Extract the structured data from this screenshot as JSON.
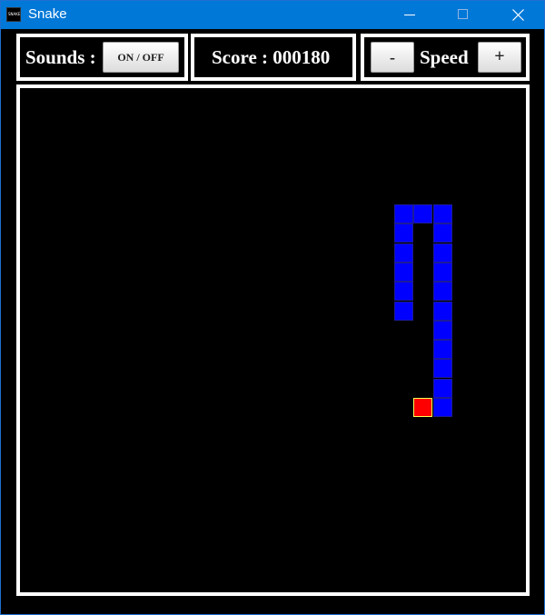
{
  "window": {
    "title": "Snake",
    "app_icon_text": "SNAKE"
  },
  "controls": {
    "sounds_label": "Sounds :",
    "sound_toggle_label": "ON / OFF",
    "score_label": "Score : 000180",
    "speed_label": "Speed",
    "speed_decrease_label": "-",
    "speed_increase_label": "+"
  },
  "game": {
    "score": 180,
    "grid_cell_unit": "cell",
    "snake_color": "#0000ff",
    "food_color": "#ff0000",
    "board_border_color": "#ffffff",
    "snake_segments": [
      {
        "col": 20,
        "row": 16
      },
      {
        "col": 20,
        "row": 15
      },
      {
        "col": 20,
        "row": 14
      },
      {
        "col": 20,
        "row": 13
      },
      {
        "col": 20,
        "row": 12
      },
      {
        "col": 20,
        "row": 11
      },
      {
        "col": 20,
        "row": 10
      },
      {
        "col": 20,
        "row": 9
      },
      {
        "col": 20,
        "row": 8
      },
      {
        "col": 20,
        "row": 7
      },
      {
        "col": 20,
        "row": 6
      },
      {
        "col": 19,
        "row": 6
      },
      {
        "col": 18,
        "row": 6
      },
      {
        "col": 18,
        "row": 7
      },
      {
        "col": 18,
        "row": 8
      },
      {
        "col": 18,
        "row": 9
      },
      {
        "col": 18,
        "row": 10
      },
      {
        "col": 18,
        "row": 11
      }
    ],
    "food": {
      "col": 19,
      "row": 16
    }
  }
}
